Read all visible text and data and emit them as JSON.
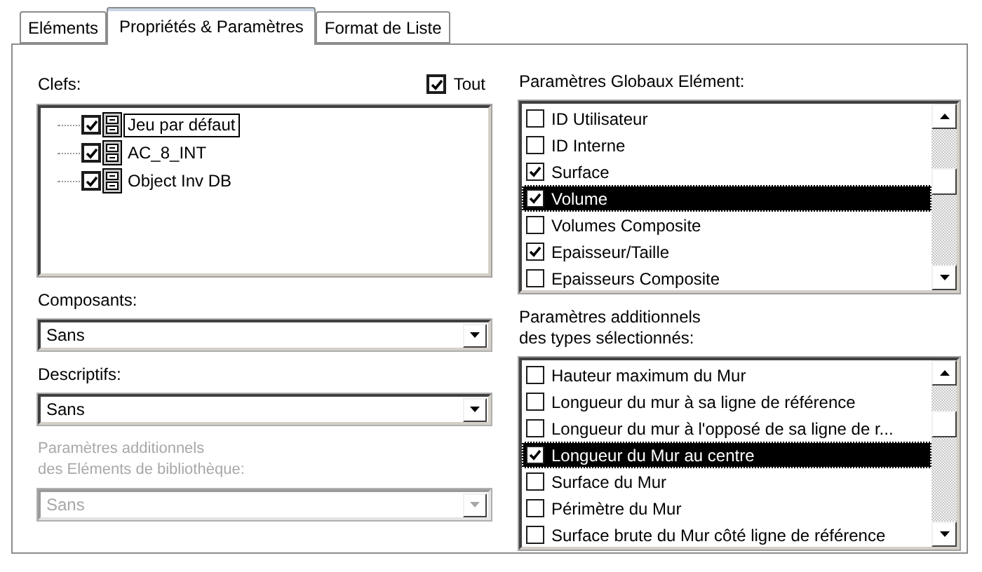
{
  "tabs": [
    {
      "label": "Eléments",
      "selected": false
    },
    {
      "label": "Propriétés & Paramètres",
      "selected": true
    },
    {
      "label": "Format de Liste",
      "selected": false
    }
  ],
  "keys": {
    "label": "Clefs:",
    "all_toggle": {
      "label": "Tout",
      "checked": true
    },
    "items": [
      {
        "label": "Jeu par défaut",
        "checked": true,
        "focused": true
      },
      {
        "label": "AC_8_INT",
        "checked": true,
        "focused": false
      },
      {
        "label": "Object Inv DB",
        "checked": true,
        "focused": false
      }
    ]
  },
  "composants": {
    "label": "Composants:",
    "value": "Sans",
    "disabled": false
  },
  "descriptifs": {
    "label": "Descriptifs:",
    "value": "Sans",
    "disabled": false
  },
  "library_params": {
    "label": "Paramètres additionnels\ndes Eléments de bibliothèque:",
    "value": "Sans",
    "disabled": true
  },
  "global_params": {
    "label": "Paramètres Globaux Elément:",
    "items": [
      {
        "label": "ID Utilisateur",
        "checked": false,
        "selected": false
      },
      {
        "label": "ID Interne",
        "checked": false,
        "selected": false
      },
      {
        "label": "Surface",
        "checked": true,
        "selected": false
      },
      {
        "label": "Volume",
        "checked": true,
        "selected": true
      },
      {
        "label": "Volumes Composite",
        "checked": false,
        "selected": false
      },
      {
        "label": "Epaisseur/Taille",
        "checked": true,
        "selected": false
      },
      {
        "label": "Epaisseurs Composite",
        "checked": false,
        "selected": false
      }
    ]
  },
  "type_params": {
    "label": "Paramètres additionnels\ndes types sélectionnés:",
    "items": [
      {
        "label": "Hauteur maximum du Mur",
        "checked": false,
        "selected": false
      },
      {
        "label": "Longueur du mur à sa ligne de référence",
        "checked": false,
        "selected": false
      },
      {
        "label": "Longueur du mur à l'opposé de sa ligne de r...",
        "checked": false,
        "selected": false
      },
      {
        "label": "Longueur du Mur au centre",
        "checked": true,
        "selected": true
      },
      {
        "label": "Surface du Mur",
        "checked": false,
        "selected": false
      },
      {
        "label": "Périmètre du Mur",
        "checked": false,
        "selected": false
      },
      {
        "label": "Surface brute du Mur côté ligne de référence",
        "checked": false,
        "selected": false
      }
    ]
  }
}
